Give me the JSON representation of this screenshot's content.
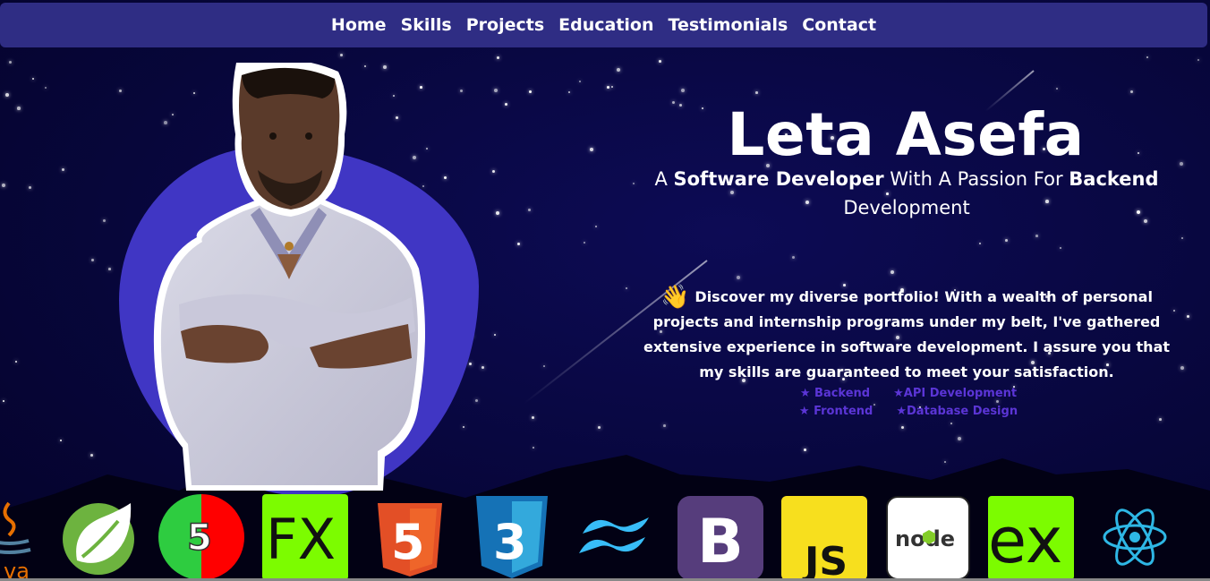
{
  "nav": {
    "items": [
      "Home",
      "Skills",
      "Projects",
      "Education",
      "Testimonials",
      "Contact"
    ]
  },
  "hero": {
    "name": "Leta Asefa",
    "tagline": {
      "prefix": "A ",
      "role": "Software Developer",
      "middle": " With A Passion For ",
      "focus": "Backend",
      "suffix": " Development"
    },
    "about": {
      "emoji": "👋",
      "text": "Discover my diverse portfolio! With a wealth of personal projects and internship programs under my belt, I've gathered extensive experience in software development. I assure you that my skills are guaranteed to meet your satisfaction."
    },
    "skills_tags": [
      [
        "★ Backend",
        "★API Development"
      ],
      [
        "★ Frontend",
        "★Database Design"
      ]
    ]
  },
  "tech_icons": [
    "java-icon",
    "spring-icon",
    "html5-badge-icon",
    "javafx-icon",
    "html5-icon",
    "css3-icon",
    "tailwind-icon",
    "bootstrap-icon",
    "javascript-icon",
    "nodejs-icon",
    "express-icon",
    "react-icon"
  ],
  "tech_text": {
    "java": "va",
    "html5_badge": "5",
    "javafx": "FX",
    "html5": "5",
    "css3": "3",
    "bootstrap": "B",
    "javascript": "JS",
    "nodejs": "node",
    "express": "ex"
  },
  "colors": {
    "background": "#07063a",
    "navbar": "#2f2d84",
    "blob": "#4036c4",
    "tag": "#5b35d6"
  }
}
